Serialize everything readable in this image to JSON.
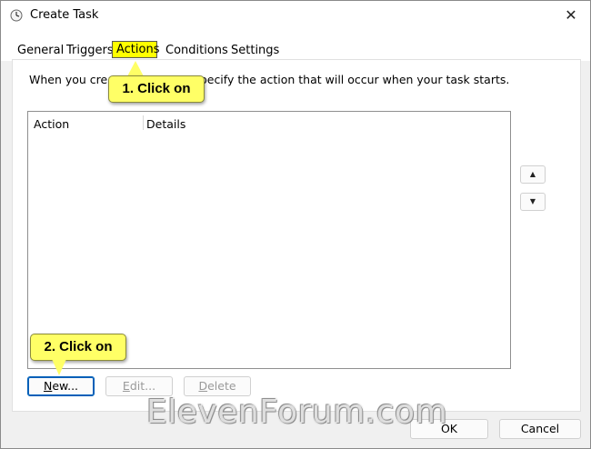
{
  "window": {
    "title": "Create Task"
  },
  "tabs": [
    {
      "label": "General"
    },
    {
      "label": "Triggers"
    },
    {
      "label": "Actions"
    },
    {
      "label": "Conditions"
    },
    {
      "label": "Settings"
    }
  ],
  "panel": {
    "description_left": "When you creat",
    "description_right": "pecify the action that will occur when your task starts."
  },
  "list": {
    "columns": [
      "Action",
      "Details"
    ]
  },
  "buttons": {
    "new_label_underline": "N",
    "new_label_rest": "ew...",
    "edit_label_underline": "E",
    "edit_label_rest": "dit...",
    "delete_label_underline": "D",
    "delete_label_rest": "elete",
    "ok_label": "OK",
    "cancel_label": "Cancel"
  },
  "callouts": {
    "step1": "1. Click on",
    "step2": "2. Click on"
  },
  "watermark": "ElevenForum.com",
  "colors": {
    "highlight": "#ffff00",
    "callout": "#ffff66",
    "accent": "#005fb8"
  }
}
